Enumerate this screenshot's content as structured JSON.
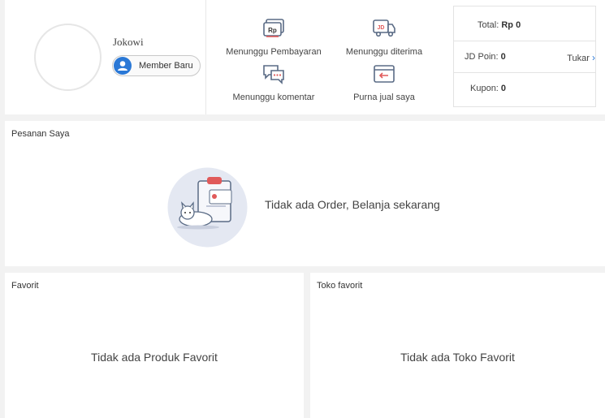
{
  "profile": {
    "username": "Jokowi",
    "member_level": "Member Baru"
  },
  "order_status": [
    {
      "label": "Menunggu Pembayaran",
      "icon": "rp-payment-icon"
    },
    {
      "label": "Menunggu diterima",
      "icon": "delivery-truck-icon"
    },
    {
      "label": "Menunggu komentar",
      "icon": "comment-bubble-icon"
    },
    {
      "label": "Purna jual saya",
      "icon": "return-box-icon"
    }
  ],
  "summary": {
    "total_key": "Total: ",
    "total_value": "Rp 0",
    "jd_poin_key": "JD Poin: ",
    "jd_poin_value": "0",
    "tukar_label": "Tukar",
    "kupon_key": "Kupon: ",
    "kupon_value": "0"
  },
  "orders": {
    "title": "Pesanan Saya",
    "empty_text": "Tidak ada Order, Belanja sekarang"
  },
  "favorites": {
    "title": "Favorit",
    "empty_text": "Tidak ada Produk Favorit"
  },
  "favorite_shops": {
    "title": "Toko favorit",
    "empty_text": "Tidak ada Toko Favorit"
  },
  "colors": {
    "accent_blue": "#2a78d6",
    "icon_gray": "#5a6b85",
    "icon_red": "#e05a5a",
    "background": "#f2f2f2"
  }
}
